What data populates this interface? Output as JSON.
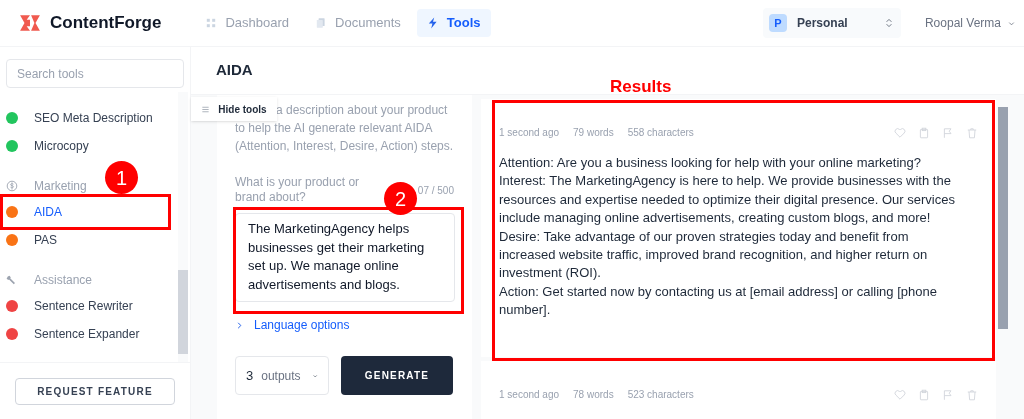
{
  "app": {
    "brand": "ContentForge"
  },
  "nav": [
    {
      "label": "Dashboard",
      "selected": false
    },
    {
      "label": "Documents",
      "selected": false
    },
    {
      "label": "Tools",
      "selected": true
    }
  ],
  "workspace": {
    "initial": "P",
    "name": "Personal"
  },
  "user": {
    "name": "Roopal Verma"
  },
  "sidebar": {
    "search": {
      "placeholder": "Search tools"
    },
    "items": [
      {
        "kind": "tool",
        "label": "SEO Meta Description",
        "color": "#22c55e",
        "selected": false
      },
      {
        "kind": "tool",
        "label": "Microcopy",
        "color": "#22c55e",
        "selected": false
      },
      {
        "kind": "group",
        "label": "Marketing"
      },
      {
        "kind": "tool",
        "label": "AIDA",
        "color": "#f97316",
        "selected": true
      },
      {
        "kind": "tool",
        "label": "PAS",
        "color": "#f97316",
        "selected": false
      },
      {
        "kind": "group",
        "label": "Assistance"
      },
      {
        "kind": "tool",
        "label": "Sentence Rewriter",
        "color": "#ef4444",
        "selected": false
      },
      {
        "kind": "tool",
        "label": "Sentence Expander",
        "color": "#ef4444",
        "selected": false
      }
    ],
    "request_button": "REQUEST FEATURE"
  },
  "page_title": "AIDA",
  "hide_tools": "Hide tools",
  "form": {
    "description": [
      "a description about your product",
      "to help the AI generate relevant AIDA (Attention, Interest, Desire, Action) steps."
    ],
    "field_label": "What is your product or brand about?",
    "counter": "07 / 500",
    "value": "The MarketingAgency helps businesses get their marketing set up. We manage online advertisements and blogs.",
    "language_options": "Language options",
    "outputs": {
      "count": "3",
      "label": "outputs"
    },
    "generate": "GENERATE"
  },
  "results": [
    {
      "time": "1 second ago",
      "words": "79 words",
      "chars": "558 characters",
      "lines": [
        "Attention: Are you a business looking for help with your online marketing?",
        "Interest: The MarketingAgency is here to help. We provide businesses with the resources and expertise needed to optimize their digital presence. Our services include managing online advertisements, creating custom blogs, and more!",
        "Desire: Take advantage of our proven strategies today and benefit from increased website traffic, improved brand recognition, and higher return on investment (ROI).",
        "Action: Get started now by contacting us at [email address] or calling [phone number]."
      ]
    },
    {
      "time": "1 second ago",
      "words": "78 words",
      "chars": "523 characters"
    }
  ],
  "annotations": {
    "results_label": "Results",
    "badges": [
      "1",
      "2"
    ]
  }
}
